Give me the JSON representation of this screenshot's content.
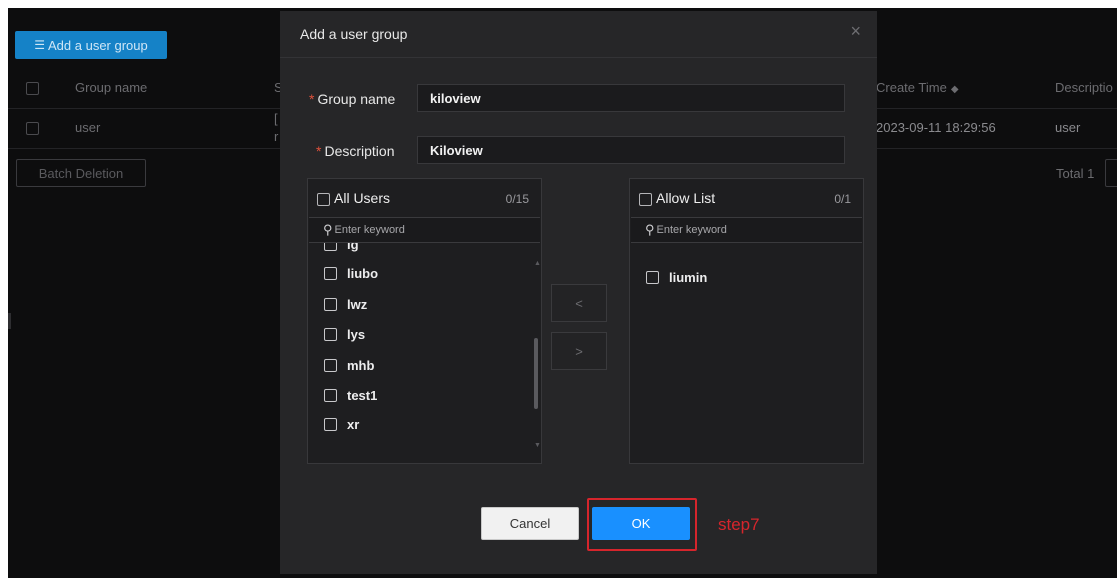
{
  "background_page": {
    "add_button_label": "Add a user group",
    "columns": {
      "group_name": "Group name",
      "create_time": "Create Time",
      "description": "Descriptio"
    },
    "row": {
      "group_name": "user",
      "partial_col": "[",
      "partial_col2": "r",
      "create_time": "2023-09-11 18:29:56",
      "description": "user"
    },
    "batch_deletion_label": "Batch Deletion",
    "total_label": "Total 1",
    "partial_header": "S"
  },
  "modal": {
    "title": "Add a user group",
    "close_icon": "×",
    "group_name_label": "Group name",
    "group_name_value": "kiloview",
    "description_label": "Description",
    "description_value": "Kiloview",
    "required_mark": "*",
    "left_panel": {
      "title": "All Users",
      "count": "0/15",
      "search_placeholder": "Enter keyword",
      "items": [
        "lg",
        "liubo",
        "lwz",
        "lys",
        "mhb",
        "test1",
        "xr"
      ]
    },
    "right_panel": {
      "title": "Allow List",
      "count": "0/1",
      "search_placeholder": "Enter keyword",
      "items": [
        "liumin"
      ]
    },
    "move_left_icon": "<",
    "move_right_icon": ">",
    "cancel_label": "Cancel",
    "ok_label": "OK",
    "step_annotation": "step7",
    "highlight_color": "#d6252c",
    "accent_color": "#1990ff"
  }
}
